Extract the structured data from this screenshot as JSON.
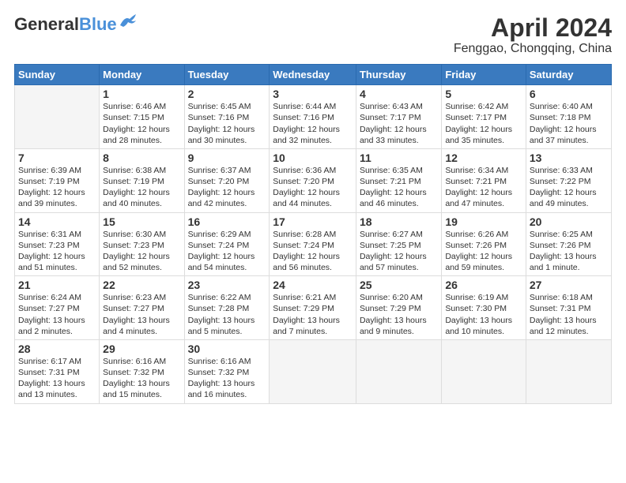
{
  "header": {
    "logo_general": "General",
    "logo_blue": "Blue",
    "month": "April 2024",
    "location": "Fenggao, Chongqing, China"
  },
  "columns": [
    "Sunday",
    "Monday",
    "Tuesday",
    "Wednesday",
    "Thursday",
    "Friday",
    "Saturday"
  ],
  "weeks": [
    [
      {
        "day": "",
        "info": ""
      },
      {
        "day": "1",
        "info": "Sunrise: 6:46 AM\nSunset: 7:15 PM\nDaylight: 12 hours\nand 28 minutes."
      },
      {
        "day": "2",
        "info": "Sunrise: 6:45 AM\nSunset: 7:16 PM\nDaylight: 12 hours\nand 30 minutes."
      },
      {
        "day": "3",
        "info": "Sunrise: 6:44 AM\nSunset: 7:16 PM\nDaylight: 12 hours\nand 32 minutes."
      },
      {
        "day": "4",
        "info": "Sunrise: 6:43 AM\nSunset: 7:17 PM\nDaylight: 12 hours\nand 33 minutes."
      },
      {
        "day": "5",
        "info": "Sunrise: 6:42 AM\nSunset: 7:17 PM\nDaylight: 12 hours\nand 35 minutes."
      },
      {
        "day": "6",
        "info": "Sunrise: 6:40 AM\nSunset: 7:18 PM\nDaylight: 12 hours\nand 37 minutes."
      }
    ],
    [
      {
        "day": "7",
        "info": "Sunrise: 6:39 AM\nSunset: 7:19 PM\nDaylight: 12 hours\nand 39 minutes."
      },
      {
        "day": "8",
        "info": "Sunrise: 6:38 AM\nSunset: 7:19 PM\nDaylight: 12 hours\nand 40 minutes."
      },
      {
        "day": "9",
        "info": "Sunrise: 6:37 AM\nSunset: 7:20 PM\nDaylight: 12 hours\nand 42 minutes."
      },
      {
        "day": "10",
        "info": "Sunrise: 6:36 AM\nSunset: 7:20 PM\nDaylight: 12 hours\nand 44 minutes."
      },
      {
        "day": "11",
        "info": "Sunrise: 6:35 AM\nSunset: 7:21 PM\nDaylight: 12 hours\nand 46 minutes."
      },
      {
        "day": "12",
        "info": "Sunrise: 6:34 AM\nSunset: 7:21 PM\nDaylight: 12 hours\nand 47 minutes."
      },
      {
        "day": "13",
        "info": "Sunrise: 6:33 AM\nSunset: 7:22 PM\nDaylight: 12 hours\nand 49 minutes."
      }
    ],
    [
      {
        "day": "14",
        "info": "Sunrise: 6:31 AM\nSunset: 7:23 PM\nDaylight: 12 hours\nand 51 minutes."
      },
      {
        "day": "15",
        "info": "Sunrise: 6:30 AM\nSunset: 7:23 PM\nDaylight: 12 hours\nand 52 minutes."
      },
      {
        "day": "16",
        "info": "Sunrise: 6:29 AM\nSunset: 7:24 PM\nDaylight: 12 hours\nand 54 minutes."
      },
      {
        "day": "17",
        "info": "Sunrise: 6:28 AM\nSunset: 7:24 PM\nDaylight: 12 hours\nand 56 minutes."
      },
      {
        "day": "18",
        "info": "Sunrise: 6:27 AM\nSunset: 7:25 PM\nDaylight: 12 hours\nand 57 minutes."
      },
      {
        "day": "19",
        "info": "Sunrise: 6:26 AM\nSunset: 7:26 PM\nDaylight: 12 hours\nand 59 minutes."
      },
      {
        "day": "20",
        "info": "Sunrise: 6:25 AM\nSunset: 7:26 PM\nDaylight: 13 hours\nand 1 minute."
      }
    ],
    [
      {
        "day": "21",
        "info": "Sunrise: 6:24 AM\nSunset: 7:27 PM\nDaylight: 13 hours\nand 2 minutes."
      },
      {
        "day": "22",
        "info": "Sunrise: 6:23 AM\nSunset: 7:27 PM\nDaylight: 13 hours\nand 4 minutes."
      },
      {
        "day": "23",
        "info": "Sunrise: 6:22 AM\nSunset: 7:28 PM\nDaylight: 13 hours\nand 5 minutes."
      },
      {
        "day": "24",
        "info": "Sunrise: 6:21 AM\nSunset: 7:29 PM\nDaylight: 13 hours\nand 7 minutes."
      },
      {
        "day": "25",
        "info": "Sunrise: 6:20 AM\nSunset: 7:29 PM\nDaylight: 13 hours\nand 9 minutes."
      },
      {
        "day": "26",
        "info": "Sunrise: 6:19 AM\nSunset: 7:30 PM\nDaylight: 13 hours\nand 10 minutes."
      },
      {
        "day": "27",
        "info": "Sunrise: 6:18 AM\nSunset: 7:31 PM\nDaylight: 13 hours\nand 12 minutes."
      }
    ],
    [
      {
        "day": "28",
        "info": "Sunrise: 6:17 AM\nSunset: 7:31 PM\nDaylight: 13 hours\nand 13 minutes."
      },
      {
        "day": "29",
        "info": "Sunrise: 6:16 AM\nSunset: 7:32 PM\nDaylight: 13 hours\nand 15 minutes."
      },
      {
        "day": "30",
        "info": "Sunrise: 6:16 AM\nSunset: 7:32 PM\nDaylight: 13 hours\nand 16 minutes."
      },
      {
        "day": "",
        "info": ""
      },
      {
        "day": "",
        "info": ""
      },
      {
        "day": "",
        "info": ""
      },
      {
        "day": "",
        "info": ""
      }
    ]
  ]
}
